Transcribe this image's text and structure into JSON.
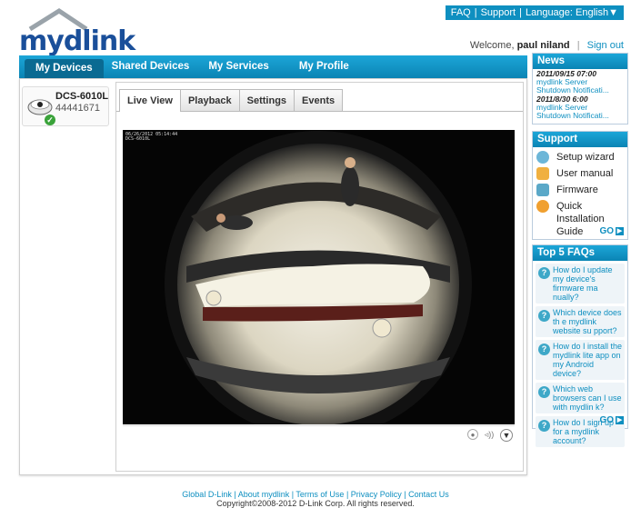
{
  "header": {
    "top_links": [
      "FAQ",
      "Support",
      "Language: English▼"
    ],
    "logo_text_my": "my",
    "logo_text_dlink": "dlink",
    "welcome_label": "Welcome,",
    "user_name": "paul niland",
    "sign_out": "Sign out"
  },
  "nav": {
    "items": [
      "My Devices",
      "Shared Devices",
      "My Services",
      "My Profile"
    ]
  },
  "device": {
    "name": "DCS-6010L",
    "id": "44441671"
  },
  "viewer": {
    "tabs": [
      "Live View",
      "Playback",
      "Settings",
      "Events"
    ],
    "timestamp_line1": "06/26/2012 05:14:44",
    "timestamp_line2": "DCS-6010L"
  },
  "news": {
    "title": "News",
    "items": [
      {
        "date": "2011/09/15 07:00",
        "source": "mydlink Server",
        "title": "Shutdown Notificati..."
      },
      {
        "date": "2011/8/30 6:00",
        "source": "mydlink Server",
        "title": "Shutdown Notificati..."
      }
    ]
  },
  "support": {
    "title": "Support",
    "items": [
      "Setup wizard",
      "User manual",
      "Firmware",
      "Quick Installation Guide"
    ],
    "go": "GO"
  },
  "faq": {
    "title": "Top 5 FAQs",
    "items": [
      "How do I update my device's firmware ma nually?",
      "Which device does th e mydlink website su pport?",
      "How do I install the mydlink lite app on my Android device?",
      "Which web browsers can I use with mydlin k?",
      "How do I sign up for a mydlink account?"
    ],
    "go": "GO"
  },
  "footer": {
    "links": [
      "Global D-Link",
      "About mydlink",
      "Terms of Use",
      "Privacy Policy",
      "Contact Us"
    ],
    "copyright": "Copyright©2008-2012 D-Link Corp. All rights reserved."
  },
  "colors": {
    "accent": "#0e8fc0",
    "nav_active": "#0a6a92",
    "logo": "#1a4f9a"
  }
}
